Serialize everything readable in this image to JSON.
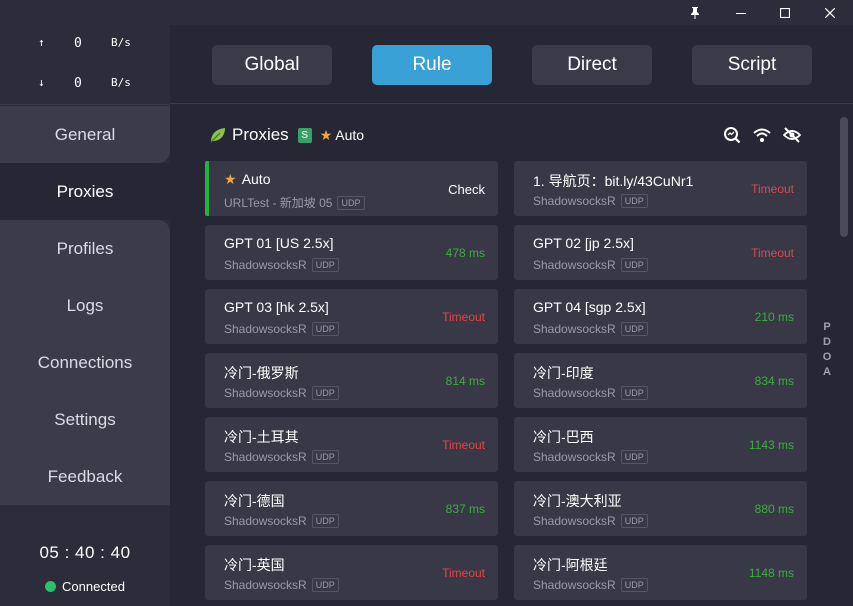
{
  "window_controls": {
    "pin": "pin-icon",
    "minimize": "minimize-icon",
    "maximize": "maximize-icon",
    "close": "close-icon"
  },
  "traffic": {
    "up": {
      "arrow": "↑",
      "value": "0",
      "unit": "B/s"
    },
    "down": {
      "arrow": "↓",
      "value": "0",
      "unit": "B/s"
    }
  },
  "nav": {
    "items": [
      {
        "label": "General"
      },
      {
        "label": "Proxies"
      },
      {
        "label": "Profiles"
      },
      {
        "label": "Logs"
      },
      {
        "label": "Connections"
      },
      {
        "label": "Settings"
      },
      {
        "label": "Feedback"
      }
    ],
    "active": "Proxies"
  },
  "footer": {
    "clock": "05 : 40 : 40",
    "status": "Connected"
  },
  "modes": {
    "global": "Global",
    "rule": "Rule",
    "direct": "Direct",
    "script": "Script",
    "active": "Rule"
  },
  "section": {
    "title": "Proxies",
    "badge": "S",
    "star": "★",
    "current": "Auto"
  },
  "side_letters": [
    "P",
    "D",
    "O",
    "A"
  ],
  "proxies": [
    {
      "name": "Auto",
      "starred": true,
      "type": "URLTest - 新加坡 05",
      "udp": "UDP",
      "delay": "Check",
      "state": "check",
      "selected": true
    },
    {
      "name": "1. 导航页：bit.ly/43CuNr1",
      "starred": false,
      "type": "ShadowsocksR",
      "udp": "UDP",
      "delay": "Timeout",
      "state": "timeout"
    },
    {
      "name": "GPT 01 [US 2.5x]",
      "starred": false,
      "type": "ShadowsocksR",
      "udp": "UDP",
      "delay": "478 ms",
      "state": "ok"
    },
    {
      "name": "GPT 02 [jp 2.5x]",
      "starred": false,
      "type": "ShadowsocksR",
      "udp": "UDP",
      "delay": "Timeout",
      "state": "timeout"
    },
    {
      "name": "GPT 03 [hk 2.5x]",
      "starred": false,
      "type": "ShadowsocksR",
      "udp": "UDP",
      "delay": "Timeout",
      "state": "timeout"
    },
    {
      "name": "GPT 04 [sgp 2.5x]",
      "starred": false,
      "type": "ShadowsocksR",
      "udp": "UDP",
      "delay": "210 ms",
      "state": "ok"
    },
    {
      "name": "冷门-俄罗斯",
      "starred": false,
      "type": "ShadowsocksR",
      "udp": "UDP",
      "delay": "814 ms",
      "state": "ok"
    },
    {
      "name": "冷门-印度",
      "starred": false,
      "type": "ShadowsocksR",
      "udp": "UDP",
      "delay": "834 ms",
      "state": "ok"
    },
    {
      "name": "冷门-土耳其",
      "starred": false,
      "type": "ShadowsocksR",
      "udp": "UDP",
      "delay": "Timeout",
      "state": "timeout"
    },
    {
      "name": "冷门-巴西",
      "starred": false,
      "type": "ShadowsocksR",
      "udp": "UDP",
      "delay": "1143 ms",
      "state": "ok"
    },
    {
      "name": "冷门-德国",
      "starred": false,
      "type": "ShadowsocksR",
      "udp": "UDP",
      "delay": "837 ms",
      "state": "ok"
    },
    {
      "name": "冷门-澳大利亚",
      "starred": false,
      "type": "ShadowsocksR",
      "udp": "UDP",
      "delay": "880 ms",
      "state": "ok"
    },
    {
      "name": "冷门-英国",
      "starred": false,
      "type": "ShadowsocksR",
      "udp": "UDP",
      "delay": "Timeout",
      "state": "timeout"
    },
    {
      "name": "冷门-阿根廷",
      "starred": false,
      "type": "ShadowsocksR",
      "udp": "UDP",
      "delay": "1148 ms",
      "state": "ok"
    }
  ],
  "colors": {
    "accent": "#3aa1d6",
    "ok": "#3cae3c",
    "timeout": "#e0474b",
    "selected": "#1fb53b",
    "star": "#f4a640"
  }
}
